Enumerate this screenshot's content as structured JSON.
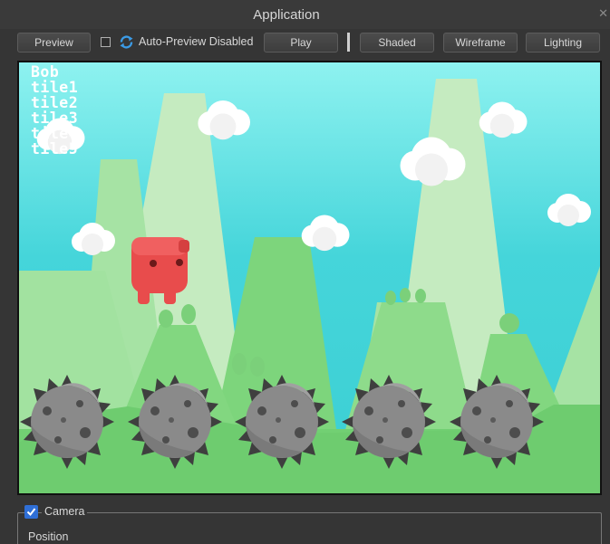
{
  "window": {
    "title": "Application",
    "close_glyph": "✕"
  },
  "toolbar": {
    "preview_label": "Preview",
    "auto_preview_label": "Auto-Preview Disabled",
    "auto_preview_checked": false,
    "play_label": "Play",
    "shaded_label": "Shaded",
    "wireframe_label": "Wireframe",
    "lighting_label": "Lighting"
  },
  "viewport": {
    "debug_lines": [
      "Bob",
      "tile1",
      "tile2",
      "tile3",
      "tile4",
      "tile5"
    ],
    "sky_color": "#8ef0ef",
    "ground_color": "#72d073",
    "character_color": "#e84c4c",
    "spike_ball_count": 5
  },
  "properties": {
    "camera_label": "Camera",
    "camera_checked": true,
    "position_label": "Position"
  },
  "colors": {
    "accent": "#2f6fd6",
    "panel": "#353535"
  }
}
